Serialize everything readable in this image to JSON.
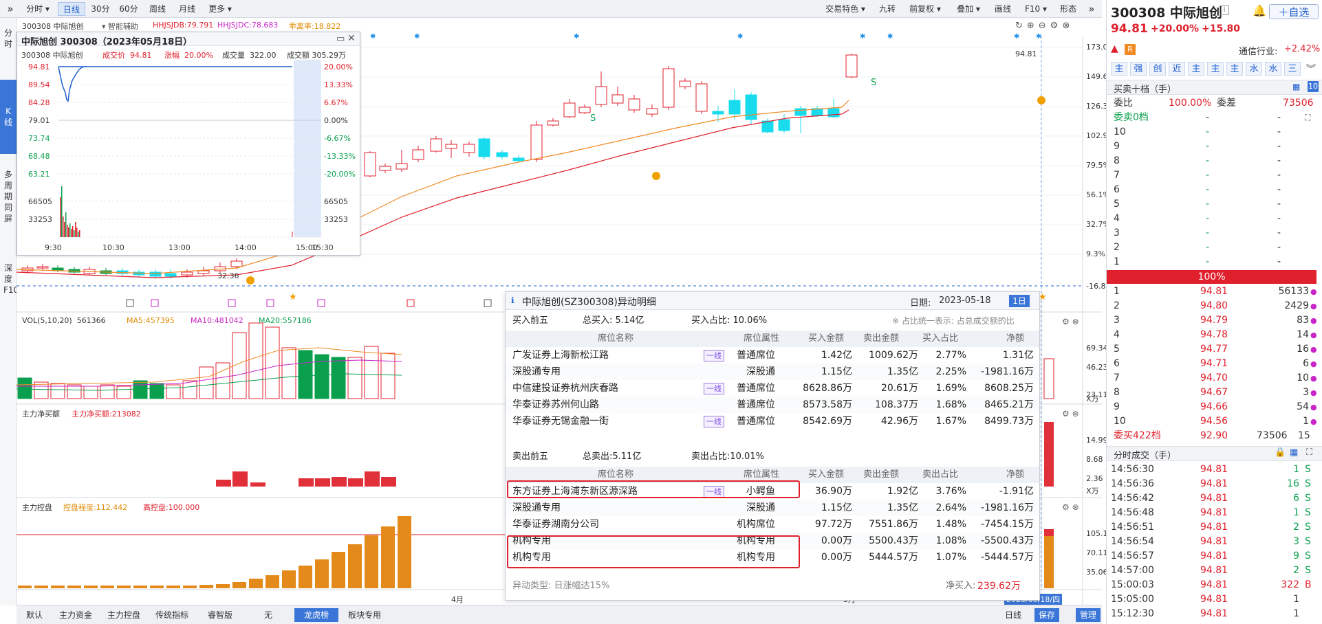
{
  "toolbar": {
    "periods": [
      "分时",
      "日线",
      "30分",
      "60分",
      "周线",
      "月线",
      "更多"
    ],
    "active_period": "日线",
    "right": [
      "交易特色",
      "九转",
      "前复权",
      "叠加",
      "画线",
      "F10",
      "形态"
    ]
  },
  "leftbar": {
    "items": [
      "分时",
      "K线",
      "多周期同屏",
      "深度F10"
    ],
    "active": "K线"
  },
  "chart": {
    "stock_line": "300308 中际旭创",
    "assist": "智能辅助",
    "indicators": [
      "HHJSJDB:79.791",
      "HHJSJDC:78.683",
      "乖离率:18.822"
    ],
    "price_axis": [
      "173.0%",
      "149.6%",
      "126.3%",
      "102.9%",
      "79.5%",
      "56.1%",
      "32.7%",
      "9.3%",
      "-16.8%"
    ],
    "high_label": "94.81",
    "low_label": "32.36",
    "vol_line": {
      "label": "VOL(5,10,20)",
      "v": "561366",
      "ma5": "MA5:457395",
      "ma10": "MA10:481042",
      "ma20": "MA20:557186"
    },
    "vol_axis": [
      "69.34",
      "46.23",
      "23.11",
      "X万"
    ],
    "net_line": {
      "label": "主力净买额",
      "v": "主力净买额:213082"
    },
    "net_axis": [
      "14.99",
      "8.68",
      "2.36",
      "X万"
    ],
    "ctrl_line": {
      "label": "主力控盘",
      "a": "控盘程度:112.442",
      "b": "高控盘:100.000"
    },
    "ctrl_axis": [
      "105.17",
      "70.11",
      "35.06"
    ],
    "x_labels": [
      "4月",
      "5月",
      "2023/05/18/四"
    ]
  },
  "mini": {
    "title": "中际旭创 300308（2023年05月18日）",
    "row1": {
      "name": "300308 中际旭创",
      "price_label": "成交价",
      "price": "94.81",
      "chg_label": "涨幅",
      "chg": "20.00%",
      "vol_label": "成交量",
      "vol": "322.00",
      "amt_label": "成交额",
      "amt": "305.29万"
    },
    "left_axis": [
      "94.81",
      "89.54",
      "84.28",
      "79.01",
      "73.74",
      "68.48",
      "63.21",
      "66505",
      "33253"
    ],
    "right_axis": [
      "20.00%",
      "13.33%",
      "6.67%",
      "0.00%",
      "-6.67%",
      "-13.33%",
      "-20.00%",
      "66505",
      "33253"
    ],
    "times": [
      "9:30",
      "10:30",
      "13:00",
      "14:00",
      "15:00",
      "15:30"
    ]
  },
  "popup": {
    "title": "中际旭创(SZ300308)异动明细",
    "date_label": "日期:",
    "date": "2023-05-18",
    "period_btn": "1日",
    "buy_section": {
      "label": "买入前五",
      "total": "总买入: 5.14亿",
      "ratio": "买入占比: 10.06%",
      "note": "※ 占比统一表示: 占总成交额的比"
    },
    "columns": [
      "席位名称",
      "席位属性",
      "买入金额",
      "卖出金额",
      "买入占比",
      "净额"
    ],
    "buy_rows": [
      {
        "name": "广发证券上海新松江路",
        "tag": "一线",
        "attr": "普通席位",
        "buy": "1.42亿",
        "sell": "1009.62万",
        "ratio": "2.77%",
        "net": "1.31亿"
      },
      {
        "name": "深股通专用",
        "tag": "",
        "attr": "深股通",
        "buy": "1.15亿",
        "sell": "1.35亿",
        "ratio": "2.25%",
        "net": "-1981.16万"
      },
      {
        "name": "中信建投证券杭州庆春路",
        "tag": "一线",
        "attr": "普通席位",
        "buy": "8628.86万",
        "sell": "20.61万",
        "ratio": "1.69%",
        "net": "8608.25万"
      },
      {
        "name": "华泰证券苏州何山路",
        "tag": "",
        "attr": "普通席位",
        "buy": "8573.58万",
        "sell": "108.37万",
        "ratio": "1.68%",
        "net": "8465.21万"
      },
      {
        "name": "华泰证券无锡金融一街",
        "tag": "一线",
        "attr": "普通席位",
        "buy": "8542.69万",
        "sell": "42.96万",
        "ratio": "1.67%",
        "net": "8499.73万"
      }
    ],
    "sell_section": {
      "label": "卖出前五",
      "total": "总卖出:5.11亿",
      "ratio": "卖出占比:10.01%"
    },
    "sell_columns": [
      "席位名称",
      "席位属性",
      "买入金额",
      "卖出金额",
      "卖出占比",
      "净额"
    ],
    "sell_rows": [
      {
        "name": "东方证券上海浦东新区源深路",
        "tag": "一线",
        "attr": "小鳄鱼",
        "buy": "36.90万",
        "sell": "1.92亿",
        "ratio": "3.76%",
        "net": "-1.91亿"
      },
      {
        "name": "深股通专用",
        "tag": "",
        "attr": "深股通",
        "buy": "1.15亿",
        "sell": "1.35亿",
        "ratio": "2.64%",
        "net": "-1981.16万"
      },
      {
        "name": "华泰证券湖南分公司",
        "tag": "",
        "attr": "机构席位",
        "buy": "97.72万",
        "sell": "7551.86万",
        "ratio": "1.48%",
        "net": "-7454.15万"
      },
      {
        "name": "机构专用",
        "tag": "",
        "attr": "机构专用",
        "buy": "0.00万",
        "sell": "5500.43万",
        "ratio": "1.08%",
        "net": "-5500.43万"
      },
      {
        "name": "机构专用",
        "tag": "",
        "attr": "机构专用",
        "buy": "0.00万",
        "sell": "5444.57万",
        "ratio": "1.07%",
        "net": "-5444.57万"
      }
    ],
    "footer_type": "异动类型: 日涨幅达15%",
    "footer_net_label": "净买入:",
    "footer_net": "239.62万"
  },
  "bottom_tabs": [
    "默认",
    "主力资金",
    "主力控盘",
    "传统指标",
    "睿智版",
    "无",
    "龙虎榜",
    "板块专用"
  ],
  "bottom_active": "龙虎榜",
  "bottom_right": [
    "日线",
    "保存",
    "管理"
  ],
  "right": {
    "title": "300308 中际旭创",
    "fav": "自选",
    "price": "94.81",
    "change": "+20.00%",
    "change_abs": "+15.80",
    "badge": "R",
    "industry": "通信行业:",
    "industry_chg": "+2.42%",
    "tabs": [
      "主",
      "强",
      "创",
      "近",
      "主",
      "主",
      "主",
      "水",
      "水",
      "三"
    ],
    "ob_title": "买卖十档（手）",
    "ob_num": "10",
    "weibi_label": "委比",
    "weibi": "100.00%",
    "weicha_label": "委差",
    "weicha": "73506",
    "wsell0": "委卖0档",
    "ask_levels": [
      "10",
      "9",
      "8",
      "7",
      "6",
      "5",
      "4",
      "3",
      "2",
      "1"
    ],
    "pct_bar": "100%",
    "bids": [
      {
        "lv": "1",
        "p": "94.81",
        "v": "56133"
      },
      {
        "lv": "2",
        "p": "94.80",
        "v": "2429"
      },
      {
        "lv": "3",
        "p": "94.79",
        "v": "83"
      },
      {
        "lv": "4",
        "p": "94.78",
        "v": "14"
      },
      {
        "lv": "5",
        "p": "94.77",
        "v": "16"
      },
      {
        "lv": "6",
        "p": "94.71",
        "v": "6"
      },
      {
        "lv": "7",
        "p": "94.70",
        "v": "10"
      },
      {
        "lv": "8",
        "p": "94.67",
        "v": "3"
      },
      {
        "lv": "9",
        "p": "94.66",
        "v": "54"
      },
      {
        "lv": "10",
        "p": "94.56",
        "v": "1"
      }
    ],
    "wbuy": {
      "label": "委买422档",
      "p": "92.90",
      "v": "73506",
      "n": "15"
    },
    "trades_title": "分时成交（手）",
    "trades": [
      {
        "t": "14:56:30",
        "p": "94.81",
        "v": "1",
        "s": "S"
      },
      {
        "t": "14:56:36",
        "p": "94.81",
        "v": "16",
        "s": "S"
      },
      {
        "t": "14:56:42",
        "p": "94.81",
        "v": "6",
        "s": "S"
      },
      {
        "t": "14:56:48",
        "p": "94.81",
        "v": "1",
        "s": "S"
      },
      {
        "t": "14:56:51",
        "p": "94.81",
        "v": "2",
        "s": "S"
      },
      {
        "t": "14:56:54",
        "p": "94.81",
        "v": "3",
        "s": "S"
      },
      {
        "t": "14:56:57",
        "p": "94.81",
        "v": "9",
        "s": "S"
      },
      {
        "t": "14:57:00",
        "p": "94.81",
        "v": "2",
        "s": "S"
      },
      {
        "t": "15:00:03",
        "p": "94.81",
        "v": "322",
        "s": "B"
      },
      {
        "t": "15:05:00",
        "p": "94.81",
        "v": "1",
        "s": ""
      },
      {
        "t": "15:12:30",
        "p": "94.81",
        "v": "1",
        "s": ""
      }
    ]
  }
}
